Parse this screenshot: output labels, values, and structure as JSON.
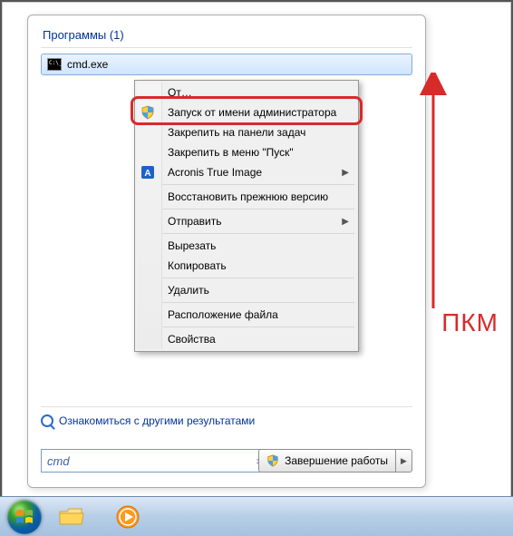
{
  "section": {
    "title": "Программы (1)"
  },
  "result": {
    "label": "cmd.exe"
  },
  "context_menu": {
    "open": "Открыть",
    "run_as_admin": "Запуск от имени администратора",
    "pin_taskbar": "Закрепить на панели задач",
    "pin_start": "Закрепить в меню \"Пуск\"",
    "acronis": "Acronis True Image",
    "restore": "Восстановить прежнюю версию",
    "send_to": "Отправить",
    "cut": "Вырезать",
    "copy": "Копировать",
    "delete": "Удалить",
    "open_location": "Расположение файла",
    "properties": "Свойства"
  },
  "see_more": "Ознакомиться с другими результатами",
  "search": {
    "value": "cmd"
  },
  "shutdown": {
    "label": "Завершение работы"
  },
  "annotation": {
    "text": "ПКМ"
  }
}
